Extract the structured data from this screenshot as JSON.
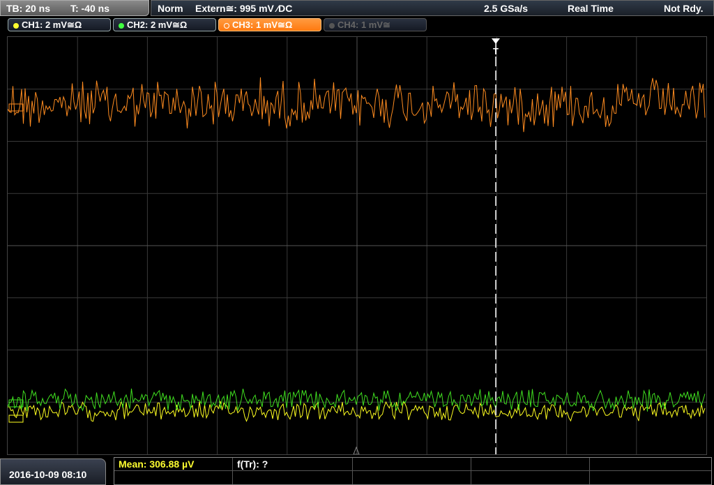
{
  "topbar": {
    "timebase": "TB: 20 ns",
    "trigger_time": "T: -40 ns",
    "mode": "Norm",
    "trigger_source": "Extern≅: 995 mV ⁄DC",
    "sample_rate": "2.5 GSa/s",
    "acquisition": "Real Time",
    "status": "Not Rdy."
  },
  "channels": [
    {
      "label": "CH1: 2 mV≅Ω",
      "color": "#ffff30",
      "state": "on"
    },
    {
      "label": "CH2: 2 mV≅Ω",
      "color": "#40ff40",
      "state": "on"
    },
    {
      "label": "CH3: 1 mV≅Ω",
      "color": "#ff8c20",
      "state": "active"
    },
    {
      "label": "CH4: 1 mV≅",
      "color": "#666666",
      "state": "off"
    }
  ],
  "trigger_marker": "T",
  "measurements": {
    "mean_label": "Mean: 306.88 µV",
    "f_label": "f(Tr): ?"
  },
  "datetime": "2016-10-09 08:10",
  "colors": {
    "ch3_trace": "#ff8c20",
    "ch2_trace": "#40e020",
    "ch1_trace": "#ffff20",
    "mean_text": "#ffff30",
    "grid": "#3a3a3a"
  }
}
